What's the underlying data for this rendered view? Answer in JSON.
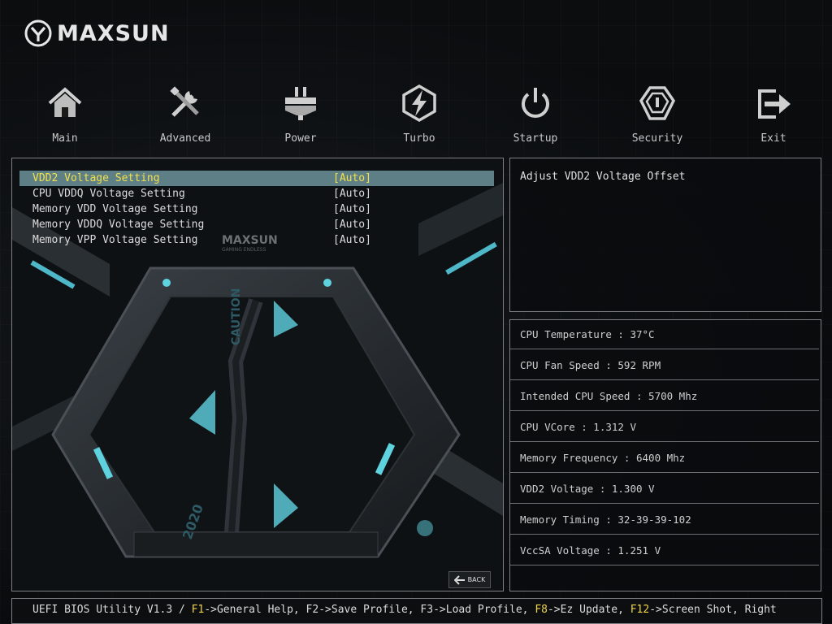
{
  "brand": {
    "name": "MAXSUN",
    "logo_icon": "maxsun-logo-icon"
  },
  "nav": [
    {
      "label": "Main",
      "icon": "home-icon"
    },
    {
      "label": "Advanced",
      "icon": "tools-icon"
    },
    {
      "label": "Power",
      "icon": "power-plug-icon"
    },
    {
      "label": "Turbo",
      "icon": "lightning-icon"
    },
    {
      "label": "Startup",
      "icon": "power-button-icon"
    },
    {
      "label": "Security",
      "icon": "shield-icon"
    },
    {
      "label": "Exit",
      "icon": "exit-icon"
    }
  ],
  "settings": [
    {
      "label": "VDD2 Voltage Setting",
      "value": "[Auto]",
      "selected": true
    },
    {
      "label": "CPU VDDQ Voltage Setting",
      "value": "[Auto]"
    },
    {
      "label": "Memory VDD Voltage Setting",
      "value": "[Auto]"
    },
    {
      "label": "Memory VDDQ Voltage Setting",
      "value": "[Auto]"
    },
    {
      "label": "Memory VPP Voltage Setting",
      "value": "[Auto]"
    }
  ],
  "help": {
    "text": "Adjust VDD2 Voltage Offset"
  },
  "hardware_info": [
    {
      "text": "CPU Temperature : 37°C"
    },
    {
      "text": "CPU Fan Speed : 592 RPM"
    },
    {
      "text": "Intended CPU Speed : 5700 Mhz"
    },
    {
      "text": "CPU VCore : 1.312 V"
    },
    {
      "text": "Memory Frequency : 6400 Mhz"
    },
    {
      "text": "VDD2 Voltage : 1.300 V"
    },
    {
      "text": "Memory Timing : 32-39-39-102"
    },
    {
      "text": "VccSA Voltage : 1.251 V"
    }
  ],
  "back_button": {
    "label": "BACK",
    "icon": "back-arrow-icon"
  },
  "status_bar": {
    "prefix": "UEFI BIOS Utility V1.3 / ",
    "f1_key": "F1",
    "f1_text": "->General Help, F2->Save Profile, F3->Load Profile, ",
    "f8_key": "F8",
    "f8_text": "->Ez Update, ",
    "f12_key": "F12",
    "f12_text": "->Screen Shot, Right"
  },
  "art_text": {
    "brand": "MAXSUN",
    "tagline": "GAMING ENDLESS",
    "caution": "CAUTION",
    "year": "2020"
  },
  "colors": {
    "selection_bg": "#5f7f87",
    "selection_text": "#f0e14a",
    "key_highlight": "#f0d44a",
    "accent_cyan": "#5fd2e0"
  }
}
